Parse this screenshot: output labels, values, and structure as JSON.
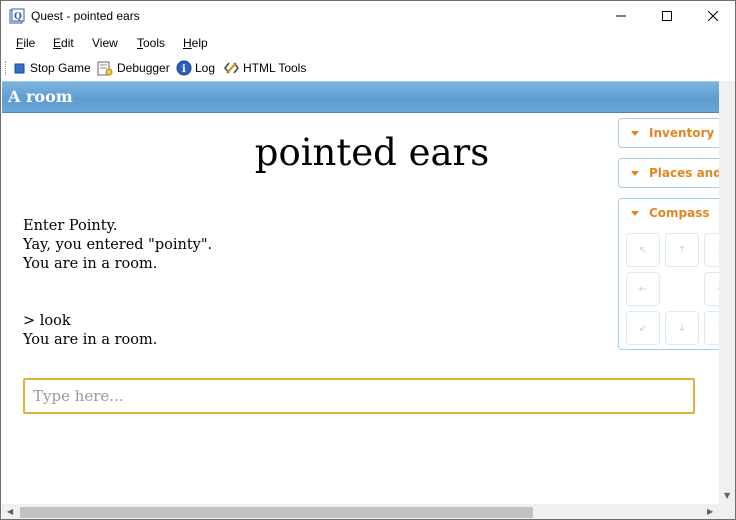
{
  "window": {
    "title": "Quest - pointed ears",
    "controls": {
      "minimize": "minimize-icon",
      "maximize": "maximize-icon",
      "close": "close-icon"
    }
  },
  "menubar": {
    "items": [
      {
        "label": "File",
        "accel": "F",
        "rest": "ile"
      },
      {
        "label": "Edit",
        "accel": "E",
        "rest": "dit"
      },
      {
        "label": "View",
        "accel": "",
        "rest": "View"
      },
      {
        "label": "Tools",
        "accel": "T",
        "rest": "ools"
      },
      {
        "label": "Help",
        "accel": "H",
        "rest": "elp"
      }
    ]
  },
  "toolbar": {
    "stop_game": "Stop Game",
    "debugger": "Debugger",
    "log": "Log",
    "html_tools": "HTML Tools"
  },
  "game": {
    "location": "A room",
    "title": "pointed ears",
    "output_block1": [
      "Enter Pointy.",
      "Yay, you entered \"pointy\".",
      "You are in a room."
    ],
    "output_block2": [
      "> look",
      "You are in a room."
    ],
    "input_placeholder": "Type here..."
  },
  "panels": {
    "inventory": "Inventory",
    "places": "Places and Objects",
    "compass": "Compass"
  },
  "colors": {
    "location_bar": "#5d9bd1",
    "panel_heading": "#e2861f",
    "input_border": "#e0b03b"
  }
}
